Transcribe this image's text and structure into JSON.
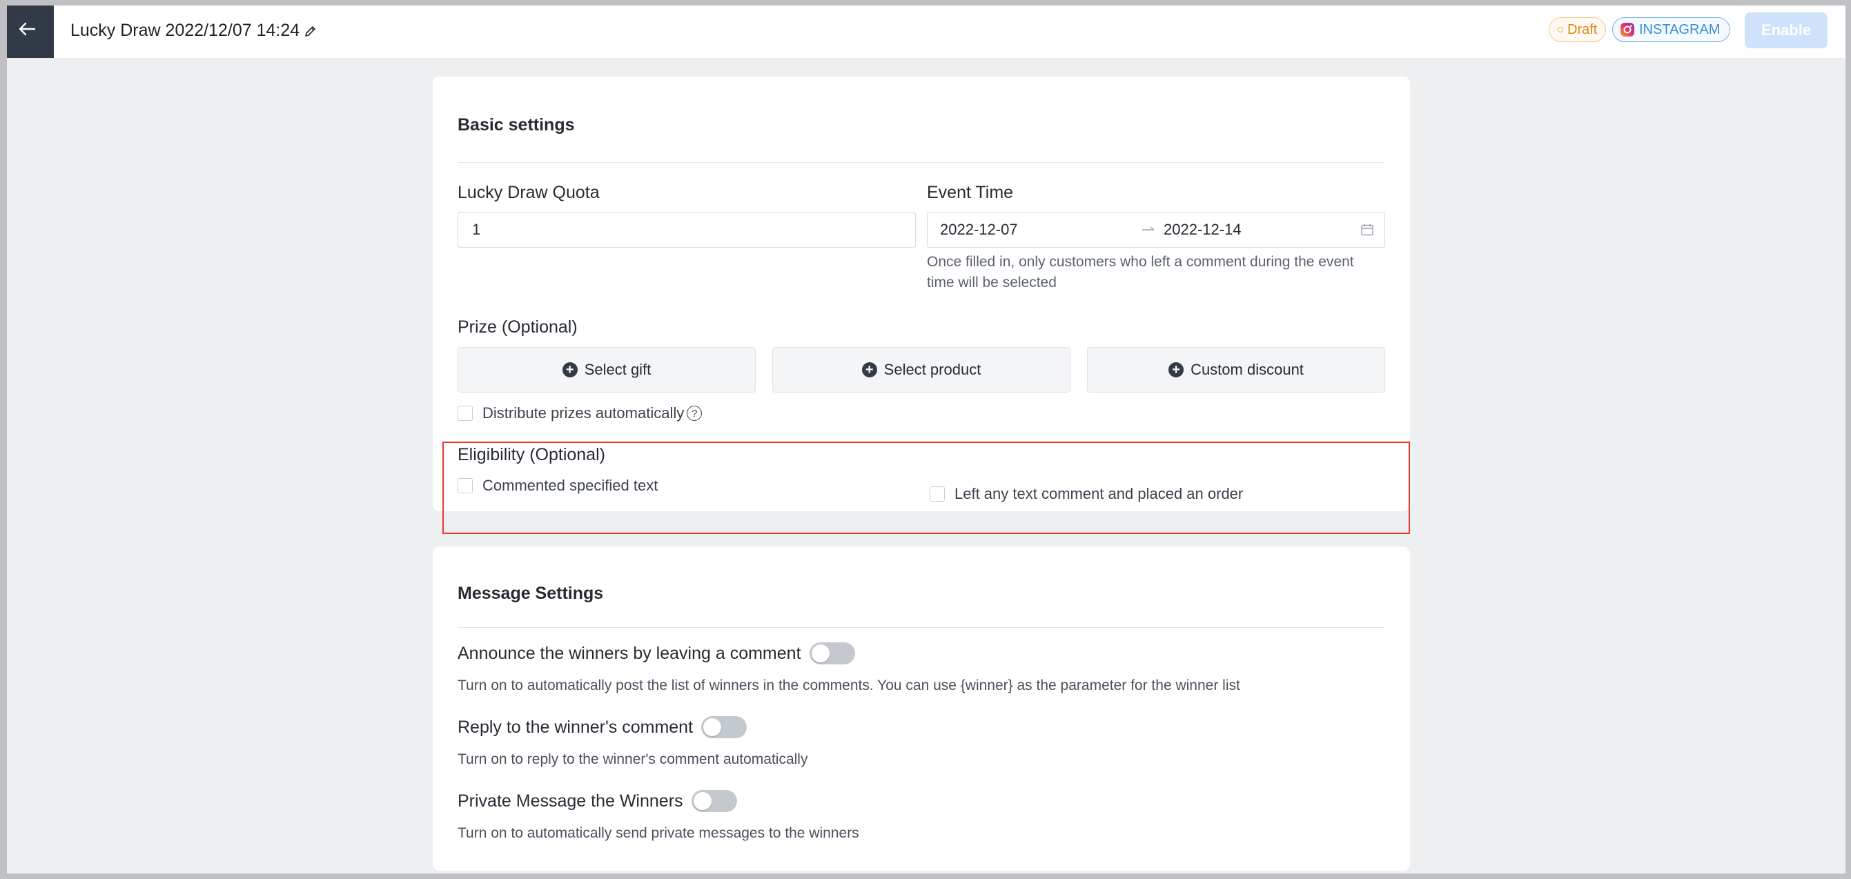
{
  "header": {
    "back_icon": "arrow-left-icon",
    "title": "Lucky Draw 2022/12/07 14:24",
    "edit_icon": "pencil-icon",
    "status_badge": "Draft",
    "platform_badge": "INSTAGRAM",
    "enable_label": "Enable"
  },
  "basic_settings": {
    "title": "Basic settings",
    "quota_label": "Lucky Draw Quota",
    "quota_value": "1",
    "event_time_label": "Event Time",
    "start_date": "2022-12-07",
    "end_date": "2022-12-14",
    "event_time_hint": "Once filled in, only customers who left a comment during the event time will be selected",
    "prize_label": "Prize (Optional)",
    "prize_buttons": [
      "Select gift",
      "Select product",
      "Custom discount"
    ],
    "distribute_label": "Distribute prizes automatically",
    "eligibility_label": "Eligibility (Optional)",
    "eligibility_options": [
      "Commented specified text",
      "Left any text comment and placed an order"
    ]
  },
  "message_settings": {
    "title": "Message Settings",
    "items": [
      {
        "label": "Announce the winners by leaving a comment",
        "desc": "Turn on to automatically post the list of winners in the comments. You can use {winner} as the parameter for the winner list",
        "enabled": false
      },
      {
        "label": "Reply to the winner's comment",
        "desc": "Turn on to reply to the winner's comment automatically",
        "enabled": false
      },
      {
        "label": "Private Message the Winners",
        "desc": "Turn on to automatically send private messages to the winners",
        "enabled": false
      }
    ]
  },
  "colors": {
    "accent_disabled": "#cfe2fb",
    "draft": "#d98a1c",
    "instagram": "#3d8fd6",
    "highlight": "#e53b2f"
  }
}
